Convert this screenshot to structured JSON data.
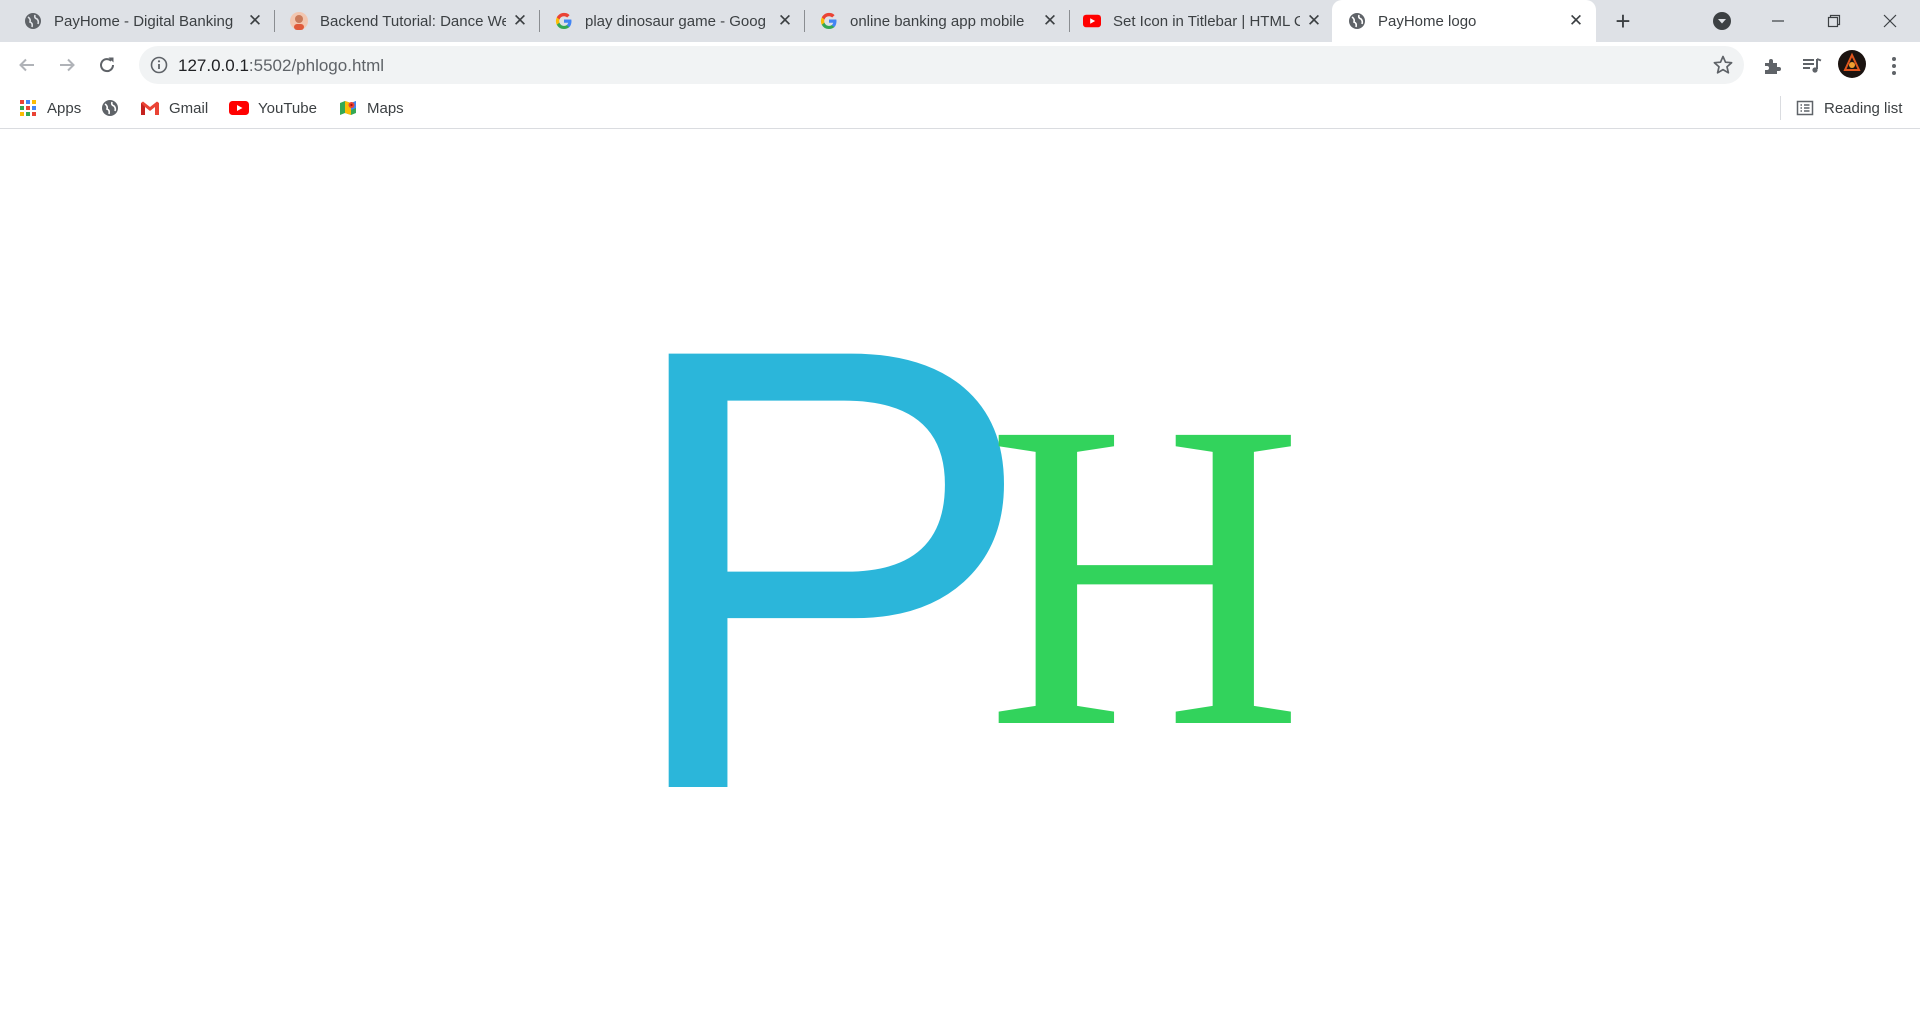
{
  "tabs": [
    {
      "title": "PayHome - Digital Banking",
      "favicon": "globe-icon",
      "active": false
    },
    {
      "title": "Backend Tutorial: Dance We",
      "favicon": "avatar-favicon-icon",
      "active": false
    },
    {
      "title": "play dinosaur game - Goog",
      "favicon": "google-icon",
      "active": false
    },
    {
      "title": "online banking app mobile",
      "favicon": "google-icon",
      "active": false
    },
    {
      "title": "Set Icon in Titlebar | HTML C",
      "favicon": "youtube-icon",
      "active": false
    },
    {
      "title": "PayHome logo",
      "favicon": "globe-icon",
      "active": true
    }
  ],
  "address_bar": {
    "host": "127.0.0.1",
    "path": ":5502/phlogo.html"
  },
  "bookmarks": {
    "apps": "Apps",
    "gmail": "Gmail",
    "youtube": "YouTube",
    "maps": "Maps",
    "reading_list": "Reading list"
  },
  "logo": {
    "letter_p": "P",
    "letter_h": "H",
    "p_color": "#2bb6da",
    "h_color": "#32d35c"
  }
}
